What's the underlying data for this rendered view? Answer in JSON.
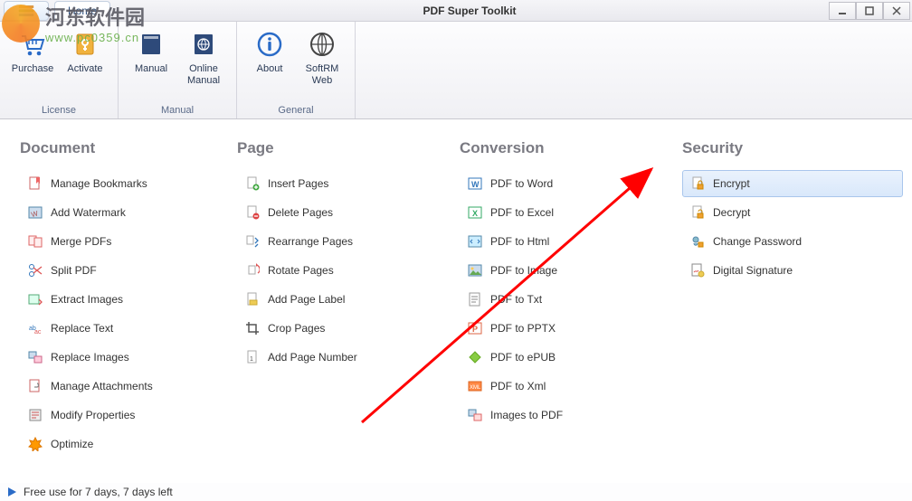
{
  "title": "PDF Super Toolkit",
  "tab_home": "Home",
  "watermark": {
    "cn": "河东软件园",
    "url": "www.pc0359.cn"
  },
  "ribbon": {
    "groups": [
      {
        "label": "License",
        "items": [
          {
            "name": "purchase",
            "label": "Purchase"
          },
          {
            "name": "activate",
            "label": "Activate"
          }
        ]
      },
      {
        "label": "Manual",
        "items": [
          {
            "name": "manual",
            "label": "Manual"
          },
          {
            "name": "online-manual",
            "label": "Online\nManual"
          }
        ]
      },
      {
        "label": "General",
        "items": [
          {
            "name": "about",
            "label": "About"
          },
          {
            "name": "softrm-web",
            "label": "SoftRM\nWeb"
          }
        ]
      }
    ]
  },
  "columns": {
    "document": {
      "header": "Document",
      "items": [
        "Manage Bookmarks",
        "Add Watermark",
        "Merge PDFs",
        "Split PDF",
        "Extract Images",
        "Replace Text",
        "Replace Images",
        "Manage Attachments",
        "Modify Properties",
        "Optimize"
      ]
    },
    "page": {
      "header": "Page",
      "items": [
        "Insert Pages",
        "Delete Pages",
        "Rearrange Pages",
        "Rotate Pages",
        "Add Page Label",
        "Crop Pages",
        "Add Page Number"
      ]
    },
    "conversion": {
      "header": "Conversion",
      "items": [
        "PDF to Word",
        "PDF to Excel",
        "PDF to Html",
        "PDF to Image",
        "PDF to Txt",
        "PDF to PPTX",
        "PDF to ePUB",
        "PDF to Xml",
        "Images to PDF"
      ]
    },
    "security": {
      "header": "Security",
      "items": [
        "Encrypt",
        "Decrypt",
        "Change Password",
        "Digital Signature"
      ]
    }
  },
  "status_text": "Free use for 7 days, 7 days left"
}
